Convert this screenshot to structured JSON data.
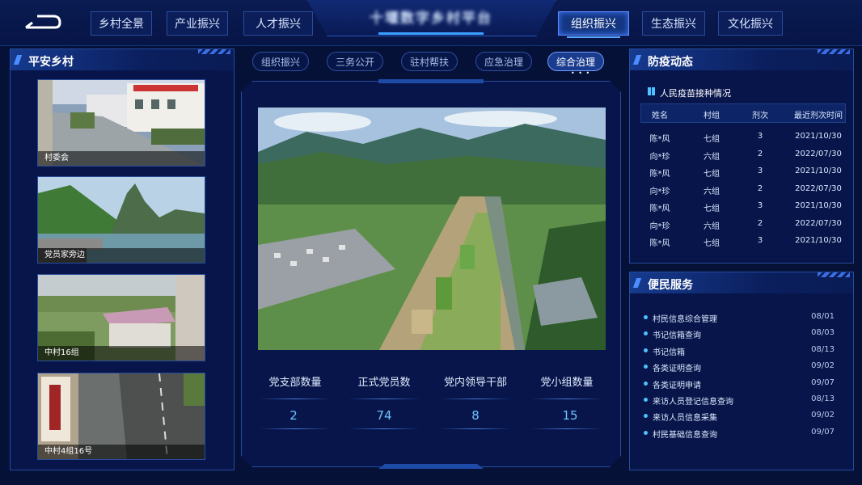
{
  "nav": {
    "left": [
      "乡村全景",
      "产业振兴",
      "人才振兴"
    ],
    "right": [
      "组织振兴",
      "生态振兴",
      "文化振兴"
    ],
    "active": "组织振兴"
  },
  "header": {
    "title": "十堰数字乡村平台"
  },
  "left_panel": {
    "title": "平安乡村",
    "cameras": [
      {
        "caption": "村委会"
      },
      {
        "caption": "党员家旁边"
      },
      {
        "caption": "中村16组"
      },
      {
        "caption": "中村4组16号"
      }
    ]
  },
  "center": {
    "tabs": [
      "组织振兴",
      "三务公开",
      "驻村帮扶",
      "应急治理",
      "综合治理"
    ],
    "active_tab": "综合治理",
    "stats": [
      {
        "label": "党支部数量",
        "value": "2"
      },
      {
        "label": "正式党员数",
        "value": "74"
      },
      {
        "label": "党内领导干部",
        "value": "8"
      },
      {
        "label": "党小组数量",
        "value": "15"
      }
    ]
  },
  "epidemic": {
    "title": "防疫动态",
    "subtitle": "人民疫苗接种情况",
    "columns": [
      "姓名",
      "村组",
      "剂次",
      "最近剂次时间"
    ],
    "rows": [
      [
        "陈*风",
        "七组",
        "3",
        "2021/10/30"
      ],
      [
        "向*珍",
        "六组",
        "2",
        "2022/07/30"
      ],
      [
        "陈*风",
        "七组",
        "3",
        "2021/10/30"
      ],
      [
        "向*珍",
        "六组",
        "2",
        "2022/07/30"
      ],
      [
        "陈*风",
        "七组",
        "3",
        "2021/10/30"
      ],
      [
        "向*珍",
        "六组",
        "2",
        "2022/07/30"
      ],
      [
        "陈*风",
        "七组",
        "3",
        "2021/10/30"
      ]
    ]
  },
  "services": {
    "title": "便民服务",
    "items": [
      {
        "label": "村民信息综合管理",
        "date": "08/01"
      },
      {
        "label": "书记信箱查询",
        "date": "08/03"
      },
      {
        "label": "书记信箱",
        "date": "08/13"
      },
      {
        "label": "各类证明查询",
        "date": "09/02"
      },
      {
        "label": "各类证明申请",
        "date": "09/07"
      },
      {
        "label": "来访人员登记信息查询",
        "date": "08/13"
      },
      {
        "label": "来访人员信息采集",
        "date": "09/02"
      },
      {
        "label": "村民基础信息查询",
        "date": "09/07"
      }
    ]
  },
  "colors": {
    "background": "#061137",
    "accent": "#3aa0ff",
    "panel_border": "#264b9e"
  }
}
